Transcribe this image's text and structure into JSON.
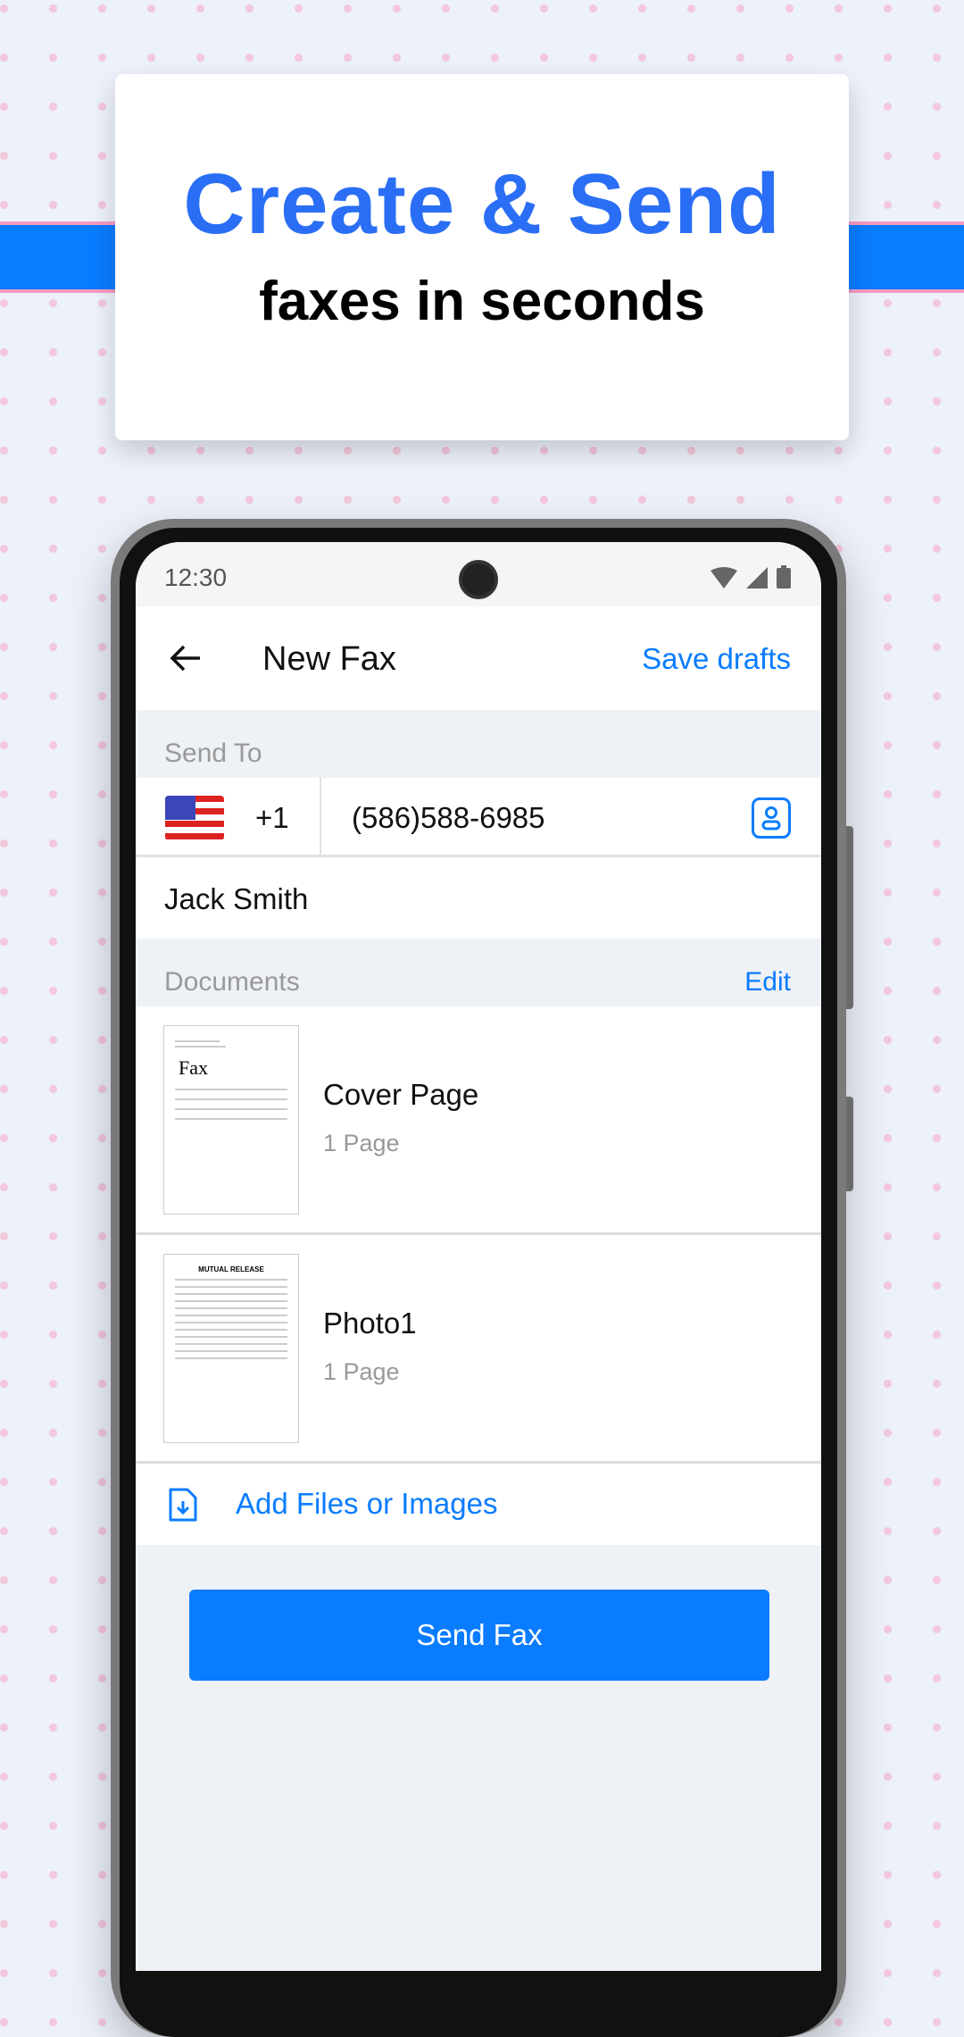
{
  "promo": {
    "headline": "Create & Send",
    "subline": "faxes in seconds"
  },
  "status_bar": {
    "time": "12:30",
    "icons": [
      "wifi-icon",
      "signal-icon",
      "battery-icon"
    ]
  },
  "app_bar": {
    "title": "New Fax",
    "save_drafts": "Save drafts"
  },
  "send_to": {
    "label": "Send To",
    "country_flag": "us-flag",
    "country_code": "+1",
    "fax_number": "(586)588-6985",
    "recipient_name": "Jack Smith"
  },
  "documents": {
    "label": "Documents",
    "edit": "Edit",
    "items": [
      {
        "name": "Cover Page",
        "pages": "1 Page",
        "thumb_title": "Fax"
      },
      {
        "name": "Photo1",
        "pages": "1 Page",
        "thumb_title": "MUTUAL RELEASE"
      }
    ],
    "add_label": "Add Files or Images"
  },
  "send_button": "Send Fax",
  "colors": {
    "accent": "#0a7cff",
    "headline": "#2a6ef5",
    "section_bg": "#eef1f5"
  }
}
